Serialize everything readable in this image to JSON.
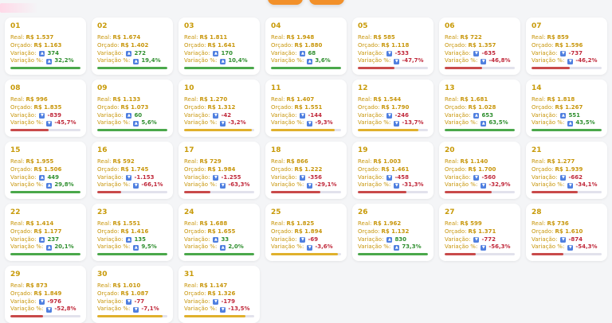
{
  "colors": {
    "green": "#4aa84a",
    "yellow": "#e0b12c",
    "red": "#c94a4a"
  },
  "labels": {
    "real": "Real:",
    "orcado": "Orçado:",
    "variacao": "Variação:",
    "variacao_pct": "Variação %:"
  },
  "days": [
    {
      "day": "01",
      "real": "R$ 1.537",
      "orcado": "R$ 1.163",
      "var": "374",
      "pct": "32,2%",
      "dir": "up",
      "bar": "green",
      "fill": 1.0
    },
    {
      "day": "02",
      "real": "R$ 1.674",
      "orcado": "R$ 1.402",
      "var": "272",
      "pct": "19,4%",
      "dir": "up",
      "bar": "green",
      "fill": 1.0
    },
    {
      "day": "03",
      "real": "R$ 1.811",
      "orcado": "R$ 1.641",
      "var": "170",
      "pct": "10,4%",
      "dir": "up",
      "bar": "green",
      "fill": 1.0
    },
    {
      "day": "04",
      "real": "R$ 1.948",
      "orcado": "R$ 1.880",
      "var": "68",
      "pct": "3,6%",
      "dir": "up",
      "bar": "green",
      "fill": 1.0
    },
    {
      "day": "05",
      "real": "R$ 585",
      "orcado": "R$ 1.118",
      "var": "-533",
      "pct": "-47,7%",
      "dir": "down",
      "bar": "red",
      "fill": 0.52
    },
    {
      "day": "06",
      "real": "R$ 722",
      "orcado": "R$ 1.357",
      "var": "-635",
      "pct": "-46,8%",
      "dir": "down",
      "bar": "red",
      "fill": 0.53
    },
    {
      "day": "07",
      "real": "R$ 859",
      "orcado": "R$ 1.596",
      "var": "-737",
      "pct": "-46,2%",
      "dir": "down",
      "bar": "red",
      "fill": 0.54
    },
    {
      "day": "08",
      "real": "R$ 996",
      "orcado": "R$ 1.835",
      "var": "-839",
      "pct": "-45,7%",
      "dir": "down",
      "bar": "red",
      "fill": 0.54
    },
    {
      "day": "09",
      "real": "R$ 1.133",
      "orcado": "R$ 1.073",
      "var": "60",
      "pct": "5,6%",
      "dir": "up",
      "bar": "green",
      "fill": 1.0
    },
    {
      "day": "10",
      "real": "R$ 1.270",
      "orcado": "R$ 1.312",
      "var": "-42",
      "pct": "-3,2%",
      "dir": "down",
      "bar": "yellow",
      "fill": 0.97
    },
    {
      "day": "11",
      "real": "R$ 1.407",
      "orcado": "R$ 1.551",
      "var": "-144",
      "pct": "-9,3%",
      "dir": "down",
      "bar": "yellow",
      "fill": 0.91
    },
    {
      "day": "12",
      "real": "R$ 1.544",
      "orcado": "R$ 1.790",
      "var": "-246",
      "pct": "-13,7%",
      "dir": "down",
      "bar": "yellow",
      "fill": 0.86
    },
    {
      "day": "13",
      "real": "R$ 1.681",
      "orcado": "R$ 1.028",
      "var": "653",
      "pct": "63,5%",
      "dir": "up",
      "bar": "green",
      "fill": 1.0
    },
    {
      "day": "14",
      "real": "R$ 1.818",
      "orcado": "R$ 1.267",
      "var": "551",
      "pct": "43,5%",
      "dir": "up",
      "bar": "green",
      "fill": 1.0
    },
    {
      "day": "15",
      "real": "R$ 1.955",
      "orcado": "R$ 1.506",
      "var": "449",
      "pct": "29,8%",
      "dir": "up",
      "bar": "green",
      "fill": 1.0
    },
    {
      "day": "16",
      "real": "R$ 592",
      "orcado": "R$ 1.745",
      "var": "-1.153",
      "pct": "-66,1%",
      "dir": "down",
      "bar": "red",
      "fill": 0.34
    },
    {
      "day": "17",
      "real": "R$ 729",
      "orcado": "R$ 1.984",
      "var": "-1.255",
      "pct": "-63,3%",
      "dir": "down",
      "bar": "red",
      "fill": 0.37
    },
    {
      "day": "18",
      "real": "R$ 866",
      "orcado": "R$ 1.222",
      "var": "-356",
      "pct": "-29,1%",
      "dir": "down",
      "bar": "red",
      "fill": 0.71
    },
    {
      "day": "19",
      "real": "R$ 1.003",
      "orcado": "R$ 1.461",
      "var": "-458",
      "pct": "-31,3%",
      "dir": "down",
      "bar": "red",
      "fill": 0.69
    },
    {
      "day": "20",
      "real": "R$ 1.140",
      "orcado": "R$ 1.700",
      "var": "-560",
      "pct": "-32,9%",
      "dir": "down",
      "bar": "red",
      "fill": 0.67
    },
    {
      "day": "21",
      "real": "R$ 1.277",
      "orcado": "R$ 1.939",
      "var": "-662",
      "pct": "-34,1%",
      "dir": "down",
      "bar": "red",
      "fill": 0.66
    },
    {
      "day": "22",
      "real": "R$ 1.414",
      "orcado": "R$ 1.177",
      "var": "237",
      "pct": "20,1%",
      "dir": "up",
      "bar": "green",
      "fill": 1.0
    },
    {
      "day": "23",
      "real": "R$ 1.551",
      "orcado": "R$ 1.416",
      "var": "135",
      "pct": "9,5%",
      "dir": "up",
      "bar": "green",
      "fill": 1.0
    },
    {
      "day": "24",
      "real": "R$ 1.688",
      "orcado": "R$ 1.655",
      "var": "33",
      "pct": "2,0%",
      "dir": "up",
      "bar": "green",
      "fill": 1.0
    },
    {
      "day": "25",
      "real": "R$ 1.825",
      "orcado": "R$ 1.894",
      "var": "-69",
      "pct": "-3,6%",
      "dir": "down",
      "bar": "yellow",
      "fill": 0.96
    },
    {
      "day": "26",
      "real": "R$ 1.962",
      "orcado": "R$ 1.132",
      "var": "830",
      "pct": "73,3%",
      "dir": "up",
      "bar": "green",
      "fill": 1.0
    },
    {
      "day": "27",
      "real": "R$ 599",
      "orcado": "R$ 1.371",
      "var": "-772",
      "pct": "-56,3%",
      "dir": "down",
      "bar": "red",
      "fill": 0.44
    },
    {
      "day": "28",
      "real": "R$ 736",
      "orcado": "R$ 1.610",
      "var": "-874",
      "pct": "-54,3%",
      "dir": "down",
      "bar": "red",
      "fill": 0.46
    },
    {
      "day": "29",
      "real": "R$ 873",
      "orcado": "R$ 1.849",
      "var": "-976",
      "pct": "-52,8%",
      "dir": "down",
      "bar": "red",
      "fill": 0.47
    },
    {
      "day": "30",
      "real": "R$ 1.010",
      "orcado": "R$ 1.087",
      "var": "-77",
      "pct": "-7,1%",
      "dir": "down",
      "bar": "yellow",
      "fill": 0.93
    },
    {
      "day": "31",
      "real": "R$ 1.147",
      "orcado": "R$ 1.326",
      "var": "-179",
      "pct": "-13,5%",
      "dir": "down",
      "bar": "yellow",
      "fill": 0.87
    }
  ]
}
